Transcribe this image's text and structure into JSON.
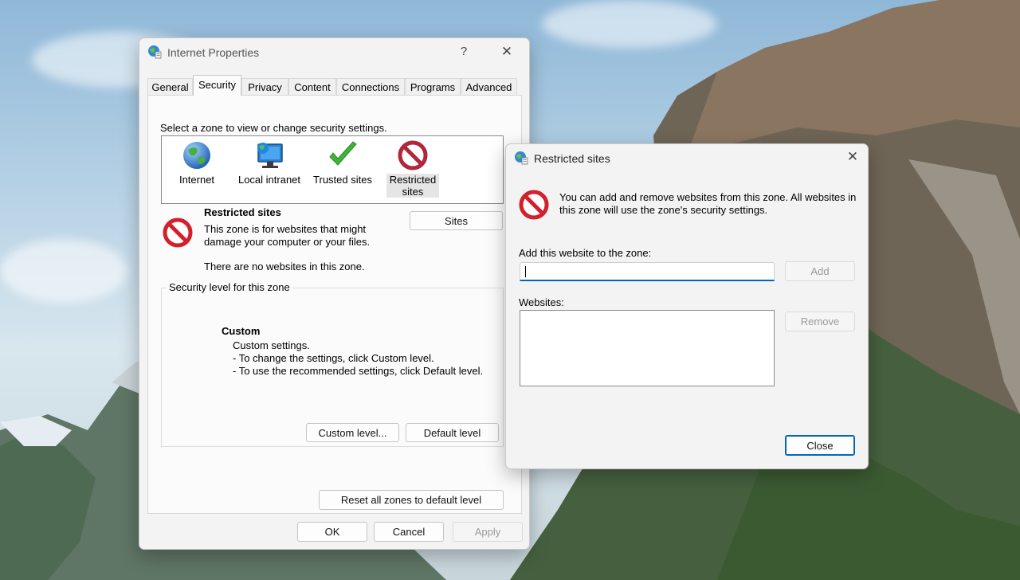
{
  "main_window": {
    "title": "Internet Properties",
    "help_glyph": "?",
    "close_glyph": "✕",
    "tabs": [
      {
        "label": "General"
      },
      {
        "label": "Security"
      },
      {
        "label": "Privacy"
      },
      {
        "label": "Content"
      },
      {
        "label": "Connections"
      },
      {
        "label": "Programs"
      },
      {
        "label": "Advanced"
      }
    ],
    "zone_prompt": "Select a zone to view or change security settings.",
    "zones": [
      {
        "label": "Internet",
        "icon": "globe-icon"
      },
      {
        "label": "Local intranet",
        "icon": "network-computer-icon"
      },
      {
        "label": "Trusted sites",
        "icon": "checkmark-icon"
      },
      {
        "label_line1": "Restricted",
        "label_line2": "sites",
        "icon": "restricted-icon"
      }
    ],
    "zone_info": {
      "heading": "Restricted sites",
      "desc_line1": "This zone is for websites that might",
      "desc_line2": "damage your computer or your files.",
      "no_sites": "There are no websites in this zone.",
      "sites_button": "Sites"
    },
    "security_level": {
      "group_title": "Security level for this zone",
      "level_name": "Custom",
      "line1": "Custom settings.",
      "line2": "- To change the settings, click Custom level.",
      "line3": "- To use the recommended settings, click Default level.",
      "custom_button": "Custom level...",
      "default_button": "Default level"
    },
    "reset_button": "Reset all zones to default level",
    "ok_button": "OK",
    "cancel_button": "Cancel",
    "apply_button": "Apply"
  },
  "restricted_dialog": {
    "title": "Restricted sites",
    "close_glyph": "✕",
    "info_line1": "You can add and remove websites from this zone. All websites in",
    "info_line2": "this zone will use the zone's security settings.",
    "add_label": "Add this website to the zone:",
    "add_value": "",
    "add_button": "Add",
    "websites_label": "Websites:",
    "remove_button": "Remove",
    "close_button": "Close"
  },
  "colors": {
    "accent": "#0067c0",
    "restricted_red": "#d0212d"
  }
}
